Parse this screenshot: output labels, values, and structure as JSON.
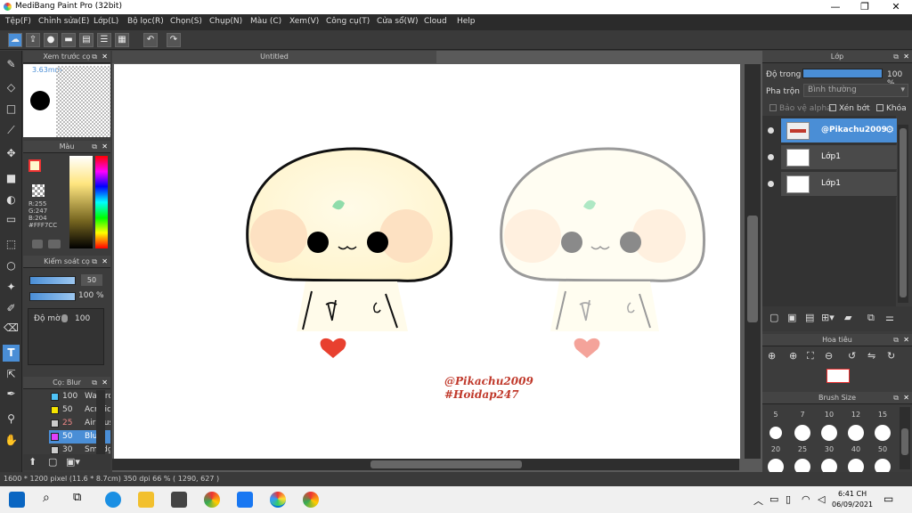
{
  "window": {
    "title": "MediBang Paint Pro (32bit)",
    "minimize": "—",
    "maximize": "❐",
    "close": "✕"
  },
  "menu": [
    "Tệp(F)",
    "Chỉnh sửa(E)",
    "Lớp(L)",
    "Bộ lọc(R)",
    "Chọn(S)",
    "Chụp(N)",
    "Màu (C)",
    "Xem(V)",
    "Công cụ(T)",
    "Cửa sổ(W)",
    "Cloud",
    "Help"
  ],
  "document": {
    "tab_title": "Untitled"
  },
  "brush_preview": {
    "title": "Xem trước cọ",
    "size": "3.63mm"
  },
  "color_panel": {
    "title": "Màu",
    "r": "R:255",
    "g": "G:247",
    "b": "B:204",
    "hex": "#FFF7CC"
  },
  "control_panel": {
    "title": "Kiểm soát cọ",
    "size_value": "50",
    "opacity_value": "100 %",
    "density_label": "Độ mờ",
    "density_value": "100"
  },
  "brush_list": {
    "title": "Cọ: Blur",
    "items": [
      {
        "size": "100",
        "name": "Watercol",
        "color": "#4fc3f7"
      },
      {
        "size": "50",
        "name": "Acrylic",
        "color": "#f5e400"
      },
      {
        "size": "25",
        "name": "Airbrush",
        "color": "#cccccc"
      },
      {
        "size": "50",
        "name": "Blur",
        "color": "#e040fb"
      },
      {
        "size": "30",
        "name": "Smudge",
        "color": "#cccccc"
      }
    ]
  },
  "layer_panel": {
    "title": "Lớp",
    "opacity_label": "Độ trong",
    "opacity_value": "100 %",
    "opacity_level": 1.0,
    "blend_label": "Pha trộn",
    "blend_value": "Bình thường",
    "protect_alpha": "Bảo vệ alpha",
    "clipping": "Xén bớt",
    "lock": "Khóa",
    "layers": [
      "@Pikachu2009",
      "Lớp1",
      "Lớp1"
    ]
  },
  "navigator": {
    "title": "Hoa tiêu"
  },
  "brush_size": {
    "title": "Brush Size",
    "row1": [
      "5",
      "7",
      "10",
      "12",
      "15"
    ],
    "row2": [
      "20",
      "25",
      "30",
      "40",
      "50"
    ]
  },
  "canvas_text": {
    "line1": "@Pikachu2009",
    "line2": "#Hoidap247"
  },
  "status": {
    "text": "1600 * 1200 pixel   (11.6 * 8.7cm)   350 dpi   66 %   ( 1290, 627 )"
  },
  "taskbar": {
    "time": "6:41 CH",
    "date": "06/09/2021"
  },
  "colors": {
    "accent": "#4a8ed6",
    "panel": "#3c3c3c",
    "heart": "#e8402f",
    "signature": "#c0392b"
  }
}
